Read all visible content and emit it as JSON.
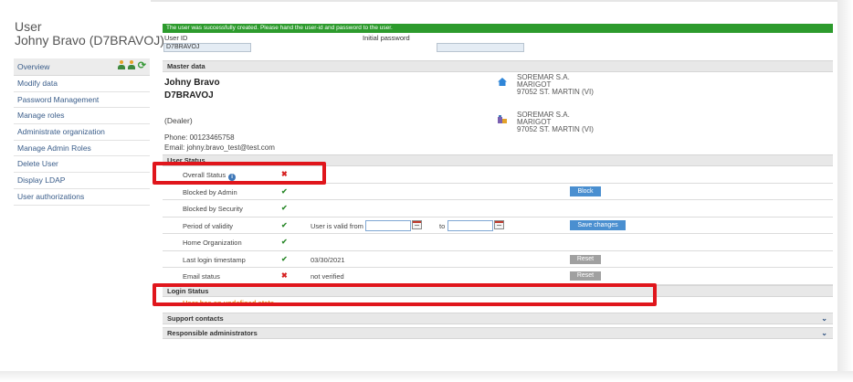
{
  "sidebar": {
    "title": "User",
    "subtitle": "Johny Bravo (D7BRAVOJ)",
    "items": [
      {
        "label": "Overview",
        "icons": [
          "person-add-icon",
          "person-icon",
          "refresh-icon"
        ]
      },
      {
        "label": "Modify data"
      },
      {
        "label": "Password Management"
      },
      {
        "label": "Manage roles"
      },
      {
        "label": "Administrate organization"
      },
      {
        "label": "Manage Admin Roles"
      },
      {
        "label": "Delete User"
      },
      {
        "label": "Display LDAP"
      },
      {
        "label": "User authorizations"
      }
    ]
  },
  "success": {
    "message": "The user was successfully created. Please hand the user-id and password to the user.",
    "color": "#2d9b2d"
  },
  "credentials": {
    "user_id_label": "User ID",
    "user_id_value": "D7BRAVOJ",
    "password_label": "Initial password",
    "password_value": ""
  },
  "master": {
    "header": "Master data",
    "name": "Johny Bravo",
    "id": "D7BRAVOJ",
    "role": "(Dealer)",
    "phone": "Phone: 00123465758",
    "email": "Email: johny.bravo_test@test.com",
    "address1": {
      "icon": "home-icon",
      "line1": "SOREMAR S.A.",
      "line2": "MARIGOT",
      "line3": "97052 ST. MARTIN (VI)"
    },
    "address2": {
      "icon": "organization-icon",
      "line1": "SOREMAR S.A.",
      "line2": "MARIGOT",
      "line3": "97052 ST. MARTIN (VI)"
    }
  },
  "user_status": {
    "header": "User Status",
    "rows": [
      {
        "label": "Overall Status",
        "mark": "✖",
        "status": "bad",
        "info_icon": "i"
      },
      {
        "label": "Blocked by Admin",
        "mark": "✔",
        "status": "ok",
        "button": "Block"
      },
      {
        "label": "Blocked by Security",
        "mark": "✔",
        "status": "ok"
      },
      {
        "label": "Period of validity",
        "mark": "✔",
        "status": "ok",
        "valid_from_label": "User is valid from",
        "to_label": "to",
        "button": "Save changes"
      },
      {
        "label": "Home Organization",
        "mark": "✔",
        "status": "ok"
      },
      {
        "label": "Last login timestamp",
        "mark": "✔",
        "status": "ok",
        "value": "03/30/2021",
        "button": "Reset"
      },
      {
        "label": "Email status",
        "mark": "✖",
        "status": "bad",
        "value": "not verified",
        "button": "Reset"
      }
    ]
  },
  "login_status": {
    "header": "Login Status",
    "message": "User has an undefined state."
  },
  "collapsed_sections": [
    {
      "label": "Support contacts"
    },
    {
      "label": "Responsible administrators"
    }
  ],
  "colors": {
    "highlight": "#e0161c",
    "ok": "#2d8a2d",
    "bad": "#d62020",
    "primary_button": "#4a8fd0",
    "warning_text": "#e88a1c"
  }
}
